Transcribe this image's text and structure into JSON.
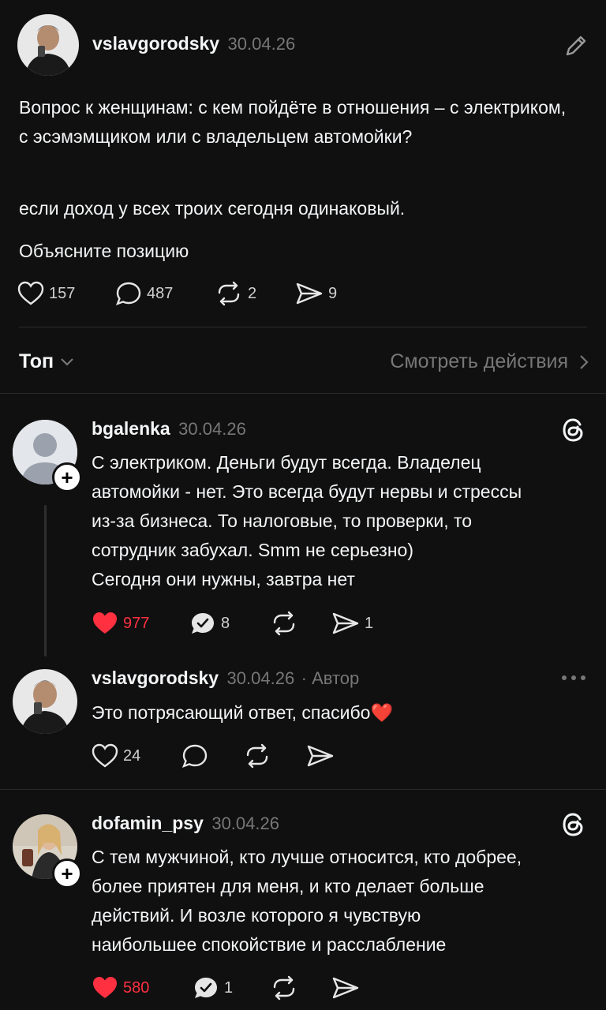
{
  "post": {
    "username": "vslavgorodsky",
    "date": "30.04.26",
    "paragraphs": [
      "Вопрос к женщинам: с кем пойдёте в отношения – с электриком, с эсэмэмщиком или с владельцем автомойки?",
      "если доход у всех троих сегодня одинаковый.",
      "Объясните позицию"
    ],
    "likes": "157",
    "comments": "487",
    "reposts": "2",
    "shares": "9"
  },
  "sort_bar": {
    "sort_label": "Топ",
    "activity_label": "Смотреть действия"
  },
  "replies": [
    {
      "username": "bgalenka",
      "date": "30.04.26",
      "text_lines": [
        "С электриком. Деньги будут всегда. Владелец",
        "автомойки - нет. Это всегда будут нервы и стрессы",
        "из-за бизнеса. То налоговые, то проверки, то",
        "сотрудник забухал. Smm не серьезно)",
        "Сегодня они нужны, завтра нет"
      ],
      "likes": "977",
      "comments": "8",
      "shares": "1"
    },
    {
      "username": "vslavgorodsky",
      "date": "30.04.26",
      "author_badge": "· Автор",
      "text": "Это потрясающий ответ, спасибо",
      "emoji": "❤️",
      "likes": "24"
    },
    {
      "username": "dofamin_psy",
      "date": "30.04.26",
      "text_lines": [
        "С тем мужчиной, кто лучше относится, кто добрее,",
        "более приятен для меня, и кто делает больше",
        "действий. И возле которого я чувствую",
        "наибольшее спокойствие и расслабление"
      ],
      "likes": "580",
      "comments": "1"
    }
  ],
  "colors": {
    "background": "#101010",
    "liked": "#ff3040",
    "muted": "#777777"
  }
}
